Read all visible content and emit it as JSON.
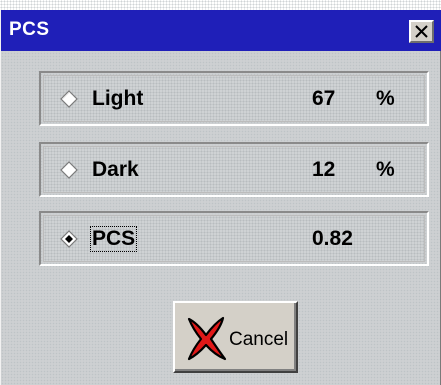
{
  "window": {
    "title": "PCS",
    "close_icon": "close-icon"
  },
  "options": [
    {
      "label": "Light",
      "value": "67",
      "unit": "%",
      "selected": false,
      "focused": false,
      "icon": "radio-diamond-icon"
    },
    {
      "label": "Dark",
      "value": "12",
      "unit": "%",
      "selected": false,
      "focused": false,
      "icon": "radio-diamond-icon"
    },
    {
      "label": "PCS",
      "value": "0.82",
      "unit": "",
      "selected": true,
      "focused": true,
      "icon": "radio-diamond-selected-icon"
    }
  ],
  "cancel_button": {
    "label": "Cancel",
    "icon": "red-x-icon"
  },
  "colors": {
    "titlebar": "#1f1fb8",
    "title_text": "#ffffff",
    "cancel_x": "#e01818"
  }
}
